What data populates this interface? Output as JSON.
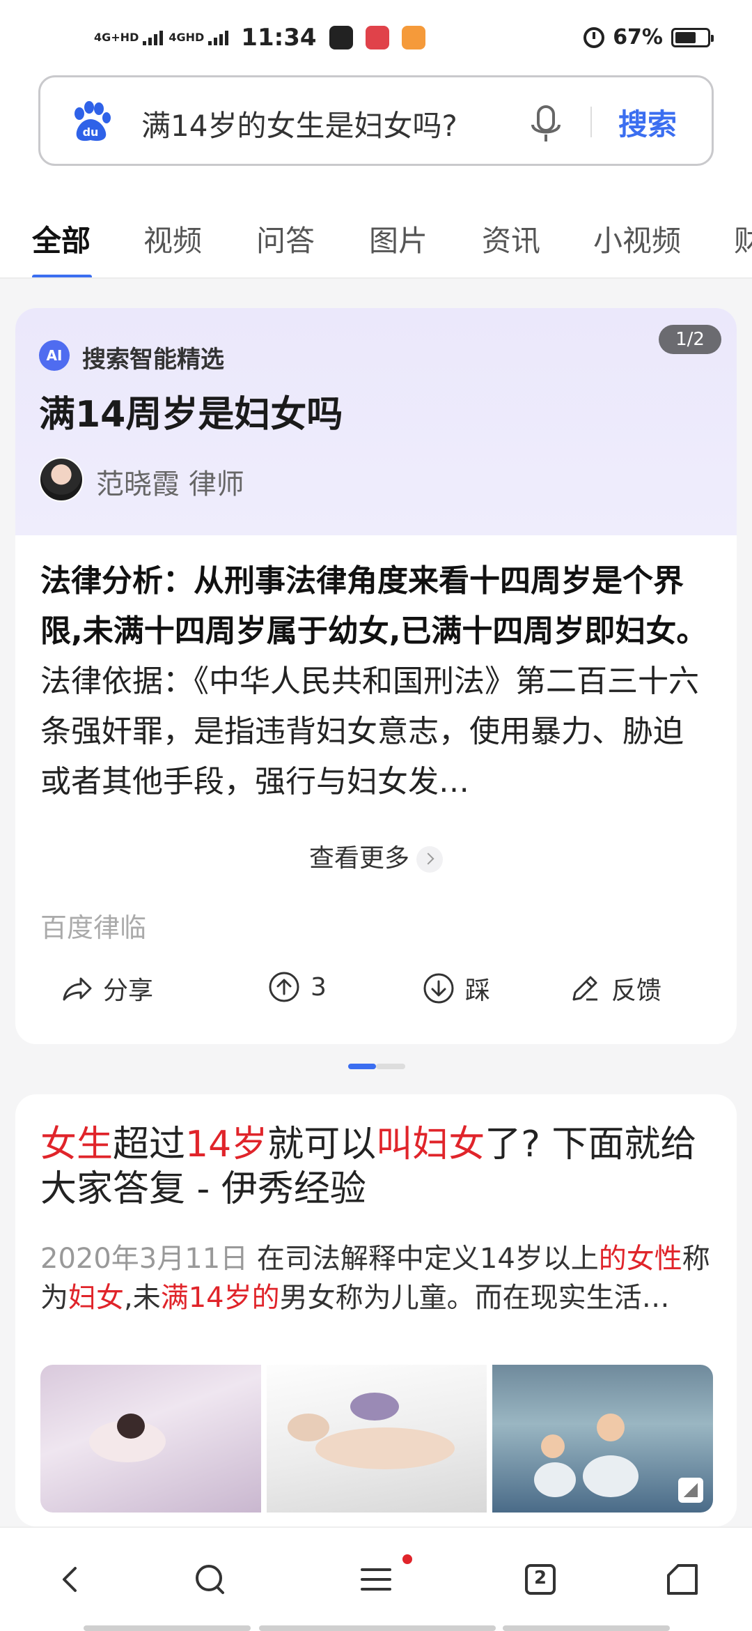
{
  "status": {
    "net1": "4G+HD",
    "net2": "4GHD",
    "time": "11:34",
    "battery_text": "67%",
    "battery_level": 0.67
  },
  "search": {
    "query": "满14岁的女生是妇女吗?",
    "button": "搜索"
  },
  "tabs": [
    "全部",
    "视频",
    "问答",
    "图片",
    "资讯",
    "小视频",
    "财"
  ],
  "ai_card": {
    "badge": "AI",
    "label": "搜索智能精选",
    "pager": "1/2",
    "title": "满14周岁是妇女吗",
    "author": "范晓霞 律师",
    "body_bold": "法律分析：从刑事法律角度来看十四周岁是个界限,未满十四周岁属于幼女,已满十四周岁即妇女。",
    "body_rest": "法律依据：《中华人民共和国刑法》第二百三十六条强奸罪，是指违背妇女意志，使用暴力、胁迫或者其他手段，强行与妇女发…",
    "more": "查看更多",
    "source": "百度律临",
    "actions": {
      "share": "分享",
      "up": "3",
      "down": "踩",
      "feedback": "反馈"
    }
  },
  "carousel": {
    "active": 1,
    "total": 2
  },
  "result": {
    "title_parts": [
      {
        "t": "女生",
        "hl": true
      },
      {
        "t": "超过",
        "hl": false
      },
      {
        "t": "14岁",
        "hl": true
      },
      {
        "t": "就可以",
        "hl": false
      },
      {
        "t": "叫妇女",
        "hl": true
      },
      {
        "t": "了? 下面就给大家答复 - 伊秀经验",
        "hl": false
      }
    ],
    "date": "2020年3月11日",
    "snippet_parts": [
      {
        "t": " 在司法解释中定义14岁以上",
        "hl": false
      },
      {
        "t": "的女性",
        "hl": true
      },
      {
        "t": "称为",
        "hl": false
      },
      {
        "t": "妇女",
        "hl": true
      },
      {
        "t": ",未",
        "hl": false
      },
      {
        "t": "满14岁的",
        "hl": true
      },
      {
        "t": "男女称为儿童。而在现实生活…",
        "hl": false
      }
    ]
  },
  "navbar": {
    "items": [
      "back-icon",
      "search-icon",
      "menu-icon",
      "tabs-icon",
      "home-icon"
    ],
    "tabs_count": "2"
  },
  "colors": {
    "accent": "#3b6ef0",
    "highlight": "#e0242a"
  }
}
